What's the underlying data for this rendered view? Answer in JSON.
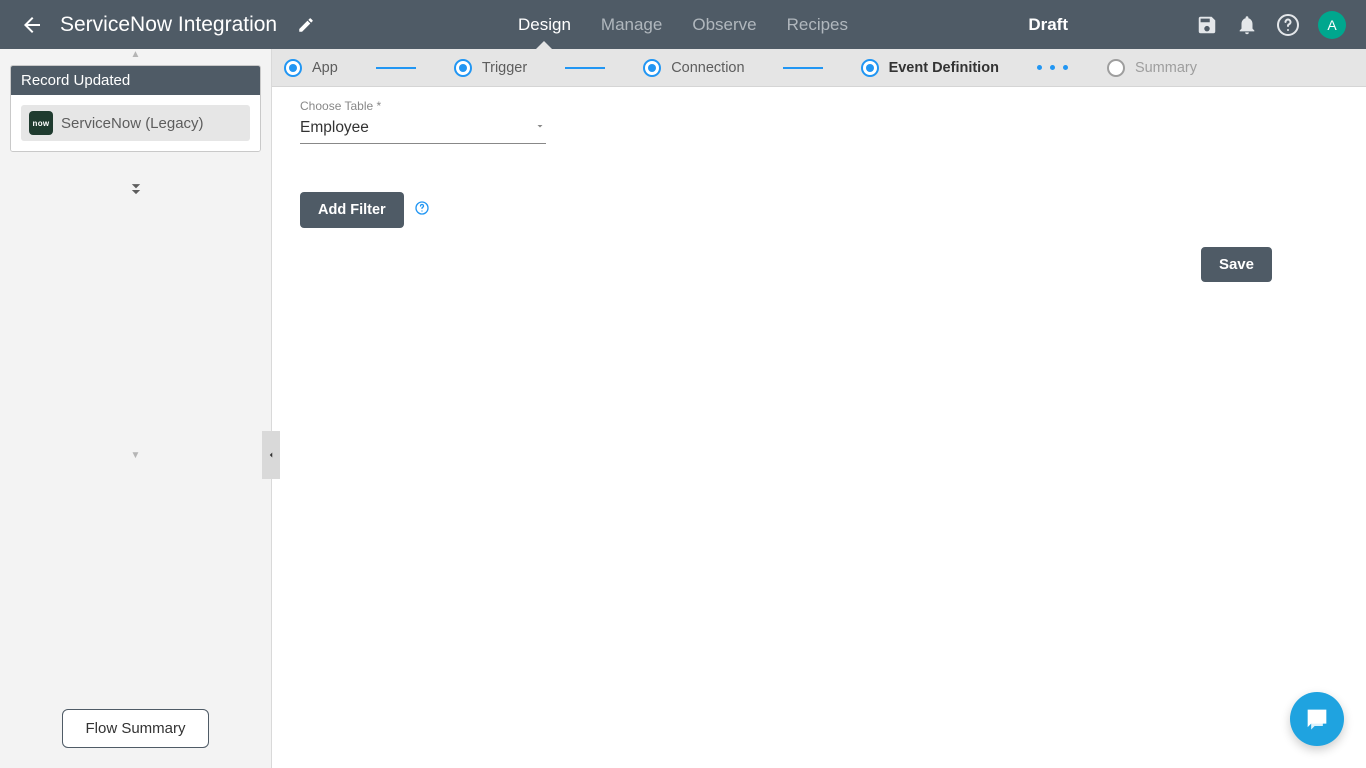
{
  "header": {
    "title": "ServiceNow Integration",
    "status": "Draft",
    "avatar_initial": "A",
    "tabs": [
      "Design",
      "Manage",
      "Observe",
      "Recipes"
    ],
    "active_tab": "Design"
  },
  "sidebar": {
    "panel_title": "Record Updated",
    "connector_label": "ServiceNow (Legacy)",
    "connector_icon_text": "now",
    "flow_summary_label": "Flow Summary"
  },
  "stepper": {
    "steps": [
      {
        "label": "App",
        "state": "done"
      },
      {
        "label": "Trigger",
        "state": "done"
      },
      {
        "label": "Connection",
        "state": "done"
      },
      {
        "label": "Event Definition",
        "state": "current"
      },
      {
        "label": "Summary",
        "state": "disabled"
      }
    ]
  },
  "form": {
    "table_field_label": "Choose Table *",
    "table_value": "Employee",
    "add_filter_label": "Add Filter",
    "save_label": "Save"
  }
}
